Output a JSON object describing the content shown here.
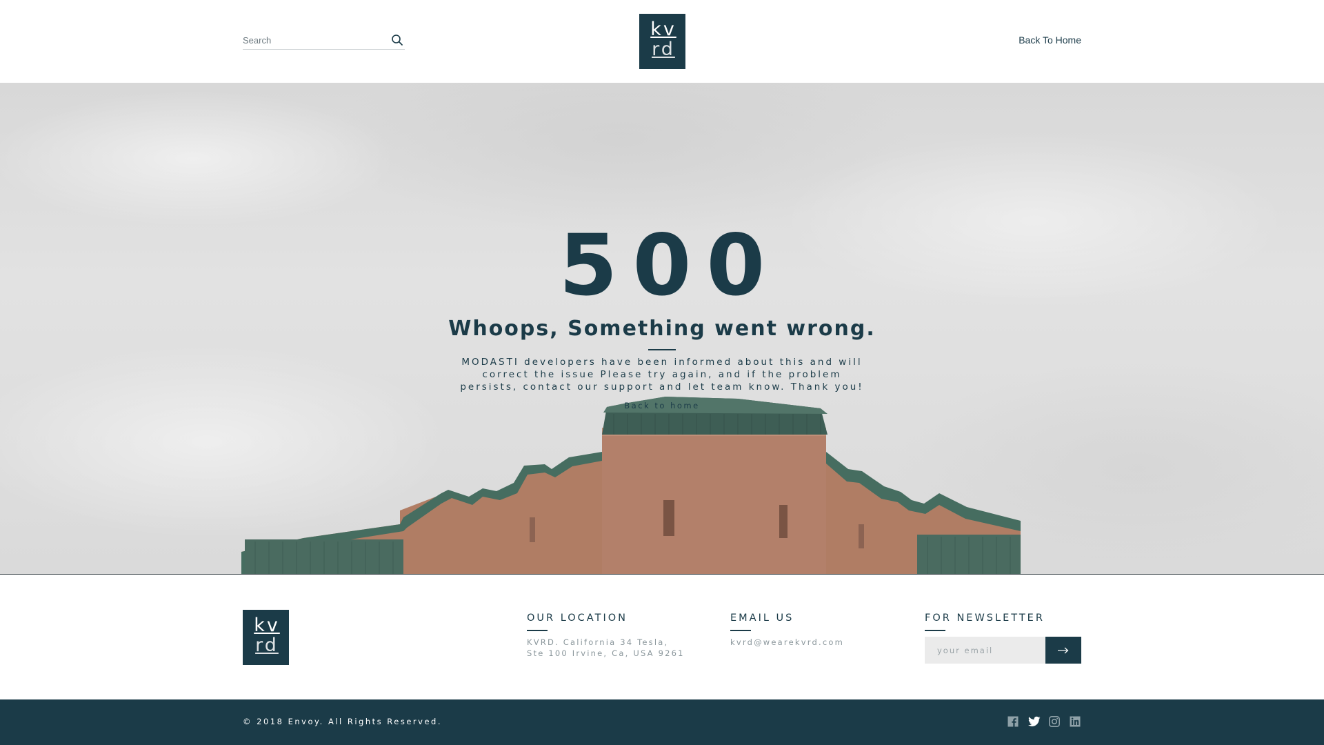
{
  "header": {
    "search_placeholder": "Search",
    "logo": {
      "line1": "kv",
      "line2": "rd"
    },
    "back_link": "Back To Home"
  },
  "hero": {
    "code": "500",
    "title": "Whoops, Something went wrong.",
    "message": "MODASTI developers have been informed  about this and will correct the issue Please try again, and if the problem persists, contact our support and let team know. Thank you!",
    "back_link": "Back to home"
  },
  "footer": {
    "logo": {
      "line1": "kv",
      "line2": "rd"
    },
    "location": {
      "heading": "OUR LOCATION",
      "line1": "KVRD. California 34 Tesla,",
      "line2": "Ste 100 Irvine, Ca, USA 9261"
    },
    "email": {
      "heading": "EMAIL US",
      "address": "kvrd@wearekvrd.com"
    },
    "newsletter": {
      "heading": "FOR NEWSLETTER",
      "placeholder": "your email",
      "submit_icon": "arrow-right-icon"
    },
    "copyright": "© 2018 Envoy. All Rights Reserved.",
    "socials": [
      "facebook-icon",
      "twitter-icon",
      "instagram-icon",
      "linkedin-icon"
    ]
  },
  "colors": {
    "brand": "#1b3b48",
    "muted_text": "#8a969b",
    "input_bg": "#ebebeb"
  }
}
